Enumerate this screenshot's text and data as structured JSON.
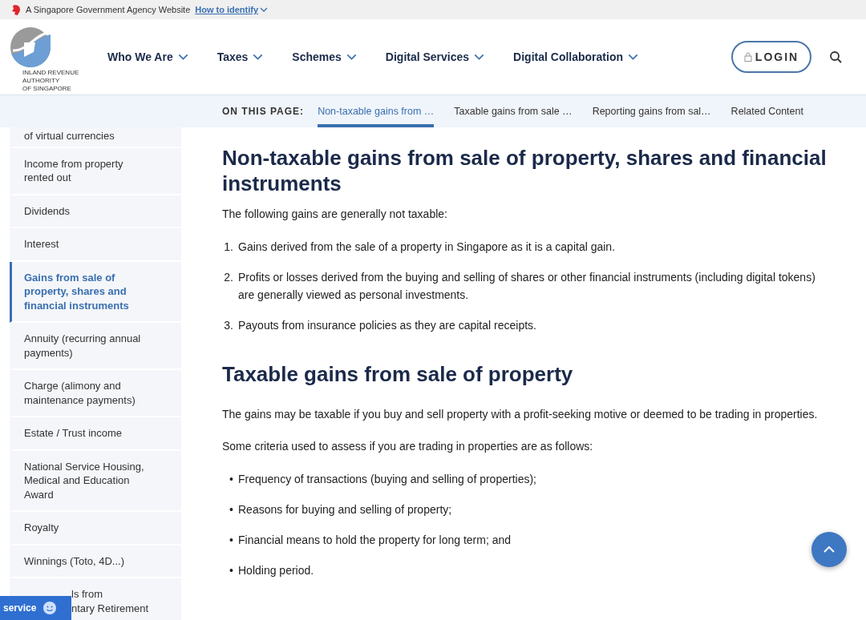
{
  "gov_banner": {
    "text": "A Singapore Government Agency Website",
    "link": "How to identify"
  },
  "header": {
    "logo_text": [
      "INLAND REVENUE",
      "AUTHORITY",
      "OF SINGAPORE"
    ],
    "nav": [
      {
        "label": "Who We Are"
      },
      {
        "label": "Taxes"
      },
      {
        "label": "Schemes"
      },
      {
        "label": "Digital Services"
      },
      {
        "label": "Digital Collaboration"
      }
    ],
    "login": "LOGIN"
  },
  "on_this_page": {
    "label": "ON THIS PAGE:",
    "links": [
      {
        "label": "Non-taxable gains from …",
        "selected": true
      },
      {
        "label": "Taxable gains from sale …",
        "selected": false
      },
      {
        "label": "Reporting gains from sal…",
        "selected": false
      },
      {
        "label": "Related Content",
        "selected": false
      }
    ]
  },
  "sidebar": {
    "items": [
      {
        "label": "of virtual currencies",
        "selected": false
      },
      {
        "label": "Income from property rented out",
        "selected": false
      },
      {
        "label": "Dividends",
        "selected": false
      },
      {
        "label": "Interest",
        "selected": false
      },
      {
        "label": "Gains from sale of property, shares and financial instruments",
        "selected": true
      },
      {
        "label": "Annuity (recurring annual payments)",
        "selected": false
      },
      {
        "label": "Charge (alimony and maintenance payments)",
        "selected": false
      },
      {
        "label": "Estate / Trust income",
        "selected": false
      },
      {
        "label": "National Service Housing, Medical and Education Award",
        "selected": false
      },
      {
        "label": "Royalty",
        "selected": false
      },
      {
        "label": "Winnings (Toto, 4D...)",
        "selected": false
      },
      {
        "label": "ls from\nntary Retirement",
        "selected": false
      }
    ]
  },
  "content": [
    {
      "kind": "heading",
      "text": "Non-taxable gains from sale of property, shares and financial instruments"
    },
    {
      "kind": "paragraph",
      "text": "The following gains are generally not taxable:"
    },
    {
      "kind": "ordered",
      "items": [
        {
          "marker": "1.",
          "text": "Gains derived from the sale of a property in Singapore as it is a capital gain."
        },
        {
          "marker": "2.",
          "text": "Profits or losses derived from the buying and selling of shares or other financial instruments (including digital tokens) are generally viewed as personal investments."
        },
        {
          "marker": "3.",
          "text": "Payouts from insurance policies as they are capital receipts."
        }
      ]
    },
    {
      "kind": "heading",
      "text": "Taxable gains from sale of property"
    },
    {
      "kind": "paragraph",
      "text": "The gains may be taxable if you buy and sell property with a profit-seeking motive or deemed to be trading in properties."
    },
    {
      "kind": "paragraph",
      "text": "Some criteria used to assess if you are trading in properties are as follows:"
    },
    {
      "kind": "bullets",
      "items": [
        {
          "marker": "•",
          "text": "Frequency of transactions (buying and selling of properties);"
        },
        {
          "marker": "•",
          "text": "Reasons for buying and selling of property;"
        },
        {
          "marker": "•",
          "text": "Financial means to hold the property for long term; and"
        },
        {
          "marker": "•",
          "text": "Holding period."
        }
      ]
    }
  ],
  "service_button": "service"
}
